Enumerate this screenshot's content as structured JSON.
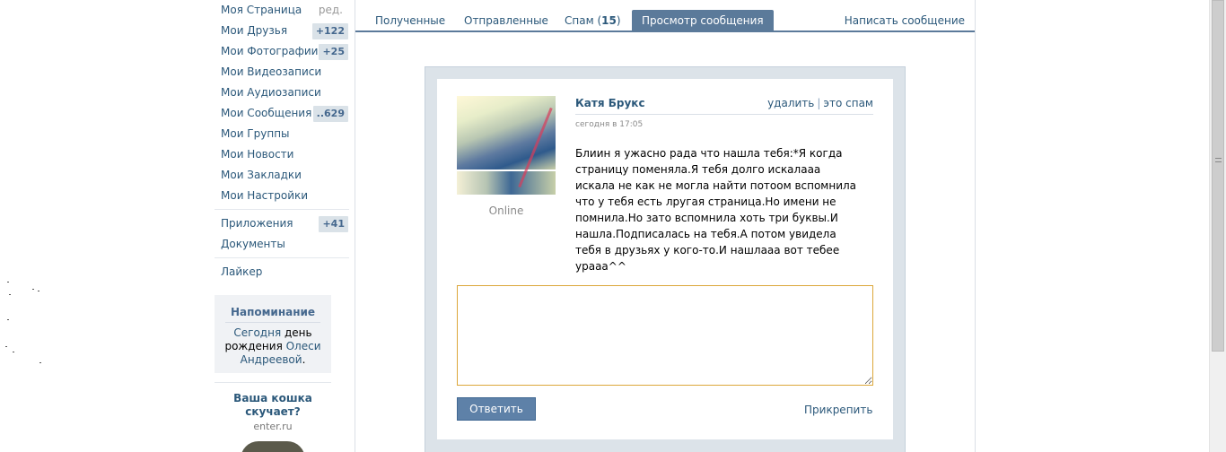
{
  "sidebar": {
    "items": [
      {
        "label": "Моя Страница",
        "extra": "ред."
      },
      {
        "label": "Мои Друзья",
        "badge": "+122"
      },
      {
        "label": "Мои Фотографии",
        "badge": "+25"
      },
      {
        "label": "Мои Видеозаписи"
      },
      {
        "label": "Мои Аудиозаписи"
      },
      {
        "label": "Мои Сообщения",
        "badge": "..629"
      },
      {
        "label": "Мои Группы"
      },
      {
        "label": "Мои Новости"
      },
      {
        "label": "Мои Закладки"
      },
      {
        "label": "Мои Настройки"
      }
    ],
    "apps": {
      "label": "Приложения",
      "badge": "+41"
    },
    "docs": {
      "label": "Документы"
    },
    "liker": {
      "label": "Лайкер"
    }
  },
  "reminder": {
    "title": "Напоминание",
    "text_today": "Сегодня",
    "text_mid": " день рождения ",
    "text_name": "Олеси Андреевой",
    "text_end": "."
  },
  "ad": {
    "title": "Ваша кошка скучает?",
    "site": "enter.ru"
  },
  "tabs": {
    "received": "Полученные",
    "sent": "Отправленные",
    "spam": "Спам",
    "spam_count": "15",
    "view": "Просмотр сообщения",
    "write": "Написать сообщение"
  },
  "message": {
    "sender": "Катя Брукс",
    "date": "сегодня в 17:05",
    "delete": "удалить",
    "separator": "|",
    "spam": "это спам",
    "status": "Online",
    "body": "Блиин я ужасно рада что нашла тебя:*Я когда страницу поменяла.Я тебя долго искалааа искала не как не могла найти потоом вспомнила что у тебя есть лругая страница.Но имени не помнила.Но зато вспомнила хоть три буквы.И нашла.Подписалась на тебя.А потом увидела тебя в друзьях у кого-то.И нашлааа вот тебее урааа^^"
  },
  "reply": {
    "button": "Ответить",
    "attach": "Прикрепить",
    "value": ""
  },
  "colors": {
    "link": "#2b587a",
    "accent": "#5b7a9a",
    "badge_bg": "#dae2e8",
    "focus_border": "#dca73a"
  }
}
